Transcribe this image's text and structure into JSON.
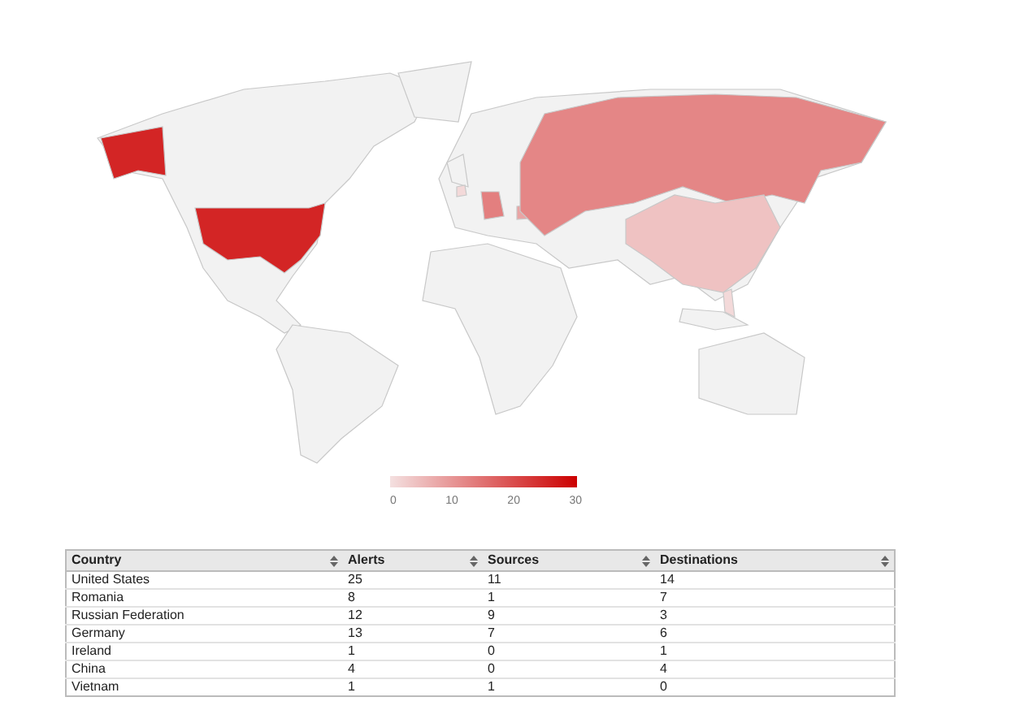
{
  "legend": {
    "ticks": [
      "0",
      "10",
      "20",
      "30"
    ]
  },
  "table": {
    "columns": [
      "Country",
      "Alerts",
      "Sources",
      "Destinations"
    ],
    "rows": [
      {
        "country": "United States",
        "alerts": "25",
        "sources": "11",
        "destinations": "14"
      },
      {
        "country": "Romania",
        "alerts": "8",
        "sources": "1",
        "destinations": "7"
      },
      {
        "country": "Russian Federation",
        "alerts": "12",
        "sources": "9",
        "destinations": "3"
      },
      {
        "country": "Germany",
        "alerts": "13",
        "sources": "7",
        "destinations": "6"
      },
      {
        "country": "Ireland",
        "alerts": "1",
        "sources": "0",
        "destinations": "1"
      },
      {
        "country": "China",
        "alerts": "4",
        "sources": "0",
        "destinations": "4"
      },
      {
        "country": "Vietnam",
        "alerts": "1",
        "sources": "1",
        "destinations": "0"
      }
    ]
  }
}
